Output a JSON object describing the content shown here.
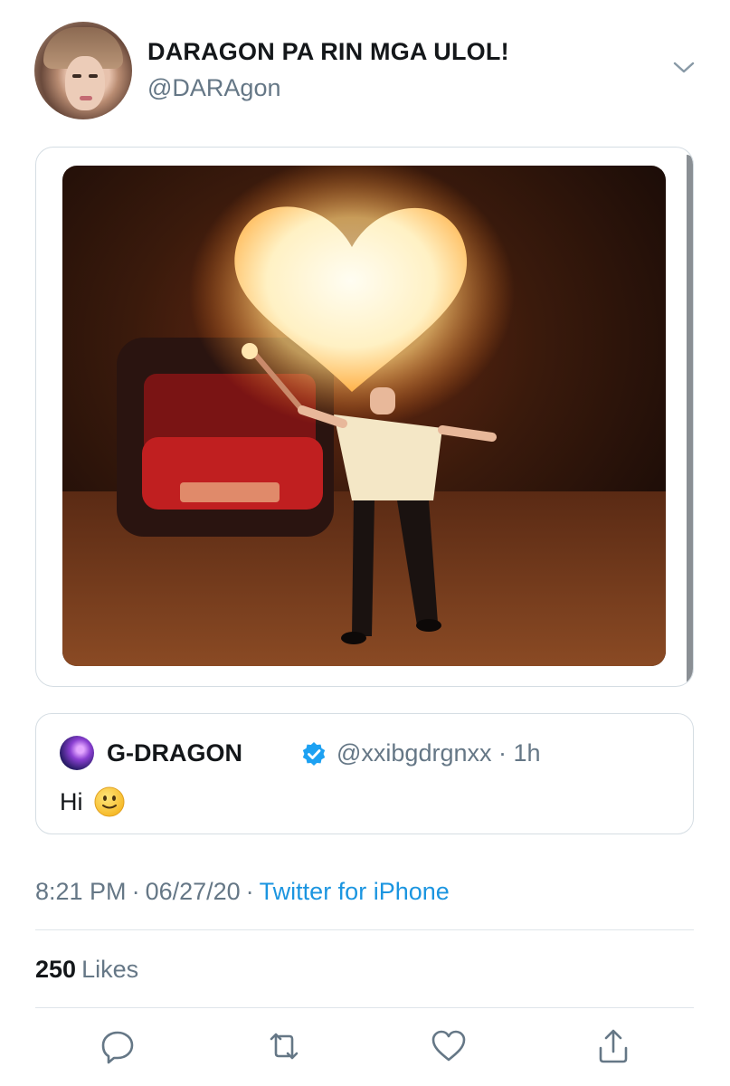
{
  "tweet": {
    "display_name": "DARAGON PA RIN MGA ULOL!",
    "handle": "@DARAgon",
    "menu_icon": "chevron-down-icon",
    "media_description": "photo"
  },
  "quoted_tweet": {
    "display_name": "G-DRAGON",
    "verified_icon": "verified-badge-icon",
    "handle_time": "@xxibgdrgnxx · 1h",
    "text": "Hi",
    "emoji_icon": "slightly-smiling-face-icon"
  },
  "meta": {
    "time": "8:21 PM",
    "date": "06/27/20",
    "separator": "·",
    "source": "Twitter for iPhone"
  },
  "stats": {
    "likes_count": "250",
    "likes_label": "Likes"
  },
  "actions": {
    "reply_icon": "reply-icon",
    "retweet_icon": "retweet-icon",
    "like_icon": "heart-icon",
    "share_icon": "share-icon"
  },
  "colors": {
    "text": "#14171a",
    "secondary": "#657786",
    "link": "#1b95e0",
    "border": "#d5dde3",
    "verified": "#1da1f2"
  }
}
